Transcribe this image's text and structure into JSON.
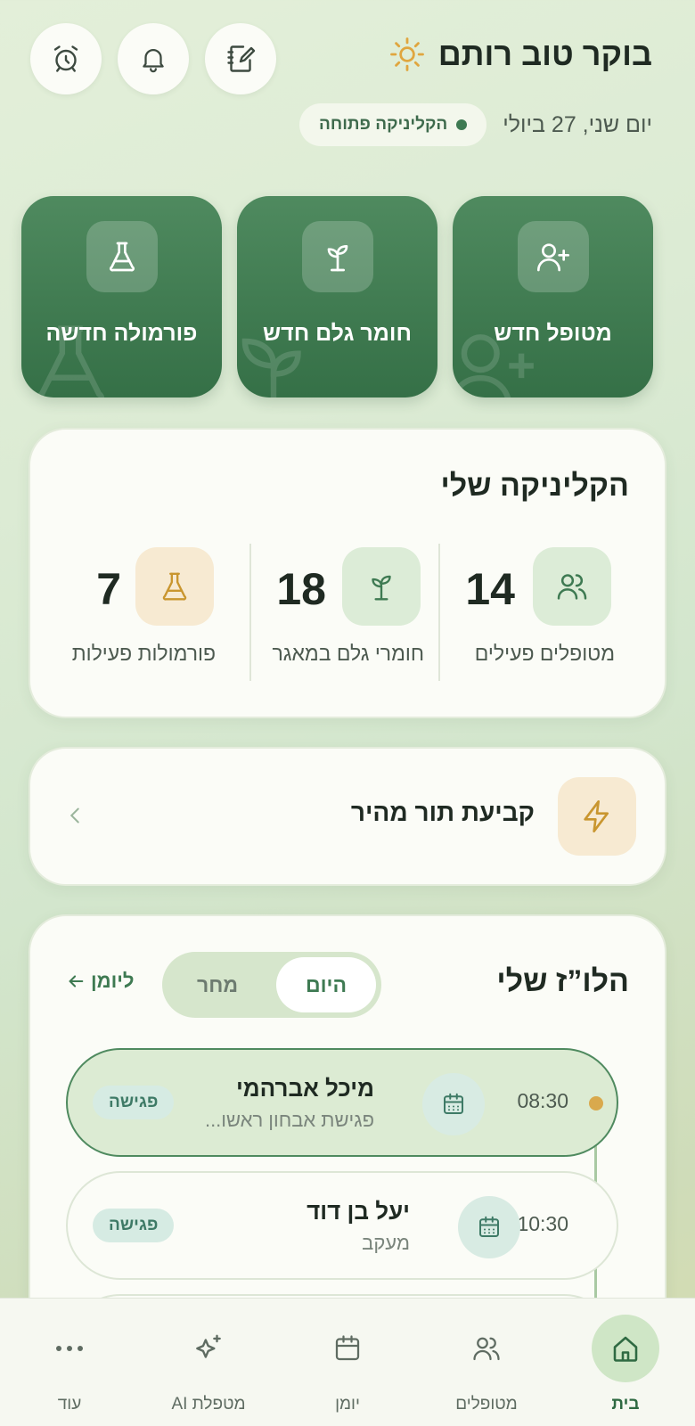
{
  "header": {
    "greeting": "בוקר טוב רותם",
    "date": "יום שני, 27 ביולי",
    "clinic_status": "הקליניקה פתוחה"
  },
  "quick_actions": [
    {
      "label": "מטופל חדש",
      "icon": "user-plus-icon"
    },
    {
      "label": "חומר גלם חדש",
      "icon": "sprout-icon"
    },
    {
      "label": "פורמולה חדשה",
      "icon": "flask-icon"
    }
  ],
  "clinic": {
    "title": "הקליניקה שלי",
    "stats": [
      {
        "value": "14",
        "label": "מטופלים פעילים",
        "icon": "users-icon"
      },
      {
        "value": "18",
        "label": "חומרי גלם במאגר",
        "icon": "sprout-icon"
      },
      {
        "value": "7",
        "label": "פורמולות פעילות",
        "icon": "flask-icon"
      }
    ]
  },
  "quick_booking": {
    "label": "קביעת תור מהיר",
    "icon": "lightning-icon"
  },
  "schedule": {
    "title": "הלו”ז שלי",
    "tabs": {
      "today": "היום",
      "tomorrow": "מחר"
    },
    "diary_link": "ליומן",
    "appointments": [
      {
        "time": "08:30",
        "name": "מיכל אברהמי",
        "subtitle": "פגישת אבחון ראשו...",
        "badge": "פגישה"
      },
      {
        "time": "10:30",
        "name": "יעל בן דוד",
        "subtitle": "מעקב",
        "badge": "פגישה"
      }
    ]
  },
  "bottom_nav": [
    {
      "label": "בית",
      "icon": "home-icon"
    },
    {
      "label": "מטופלים",
      "icon": "users-icon"
    },
    {
      "label": "יומן",
      "icon": "calendar-icon"
    },
    {
      "label": "מטפלת AI",
      "icon": "sparkles-icon"
    },
    {
      "label": "עוד",
      "icon": "more-icon"
    }
  ],
  "colors": {
    "primary_green": "#3f7a50",
    "accent_gold": "#d9a94d",
    "card_bg": "#fbfcf7"
  }
}
